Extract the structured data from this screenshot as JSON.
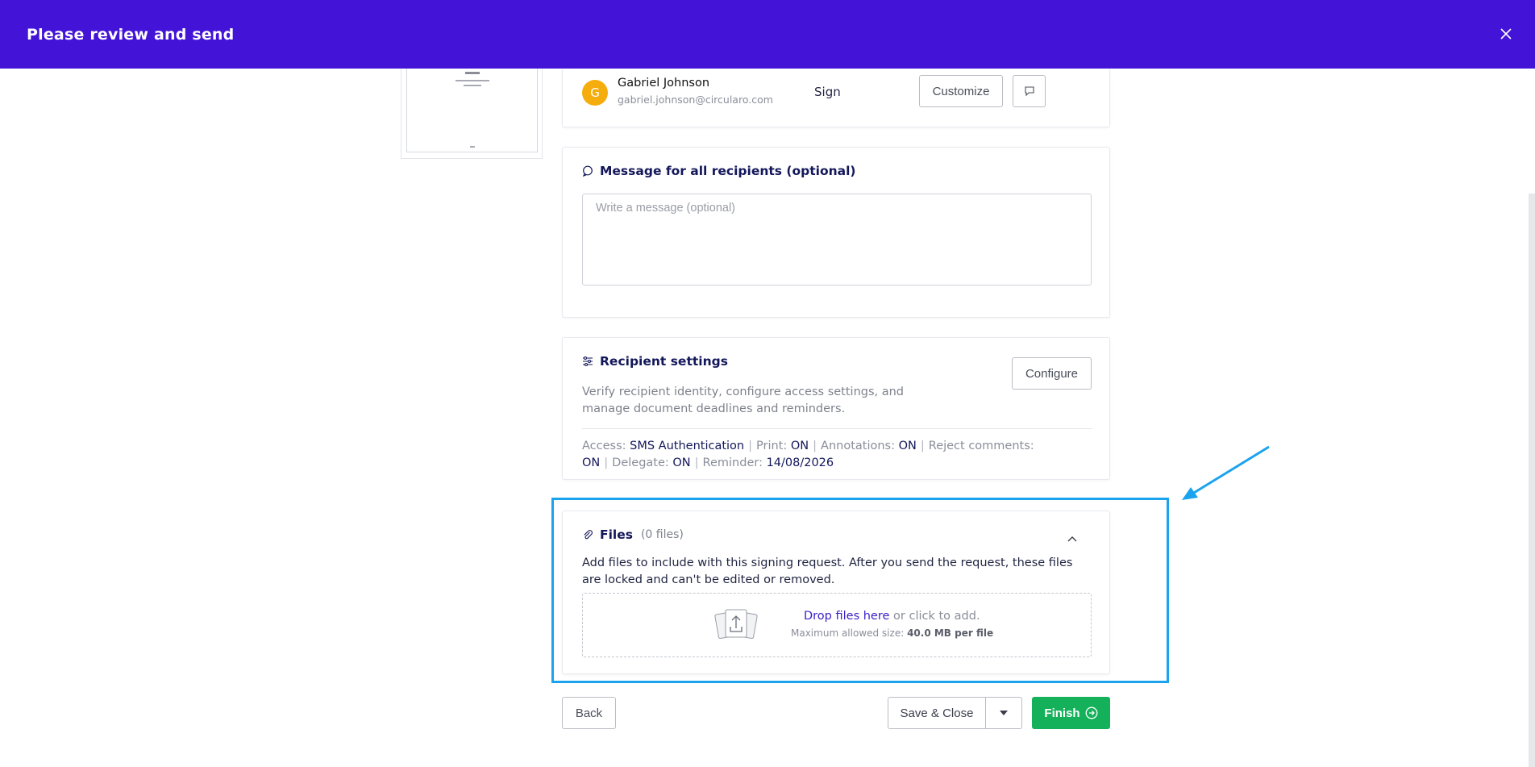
{
  "header": {
    "title": "Please review and send"
  },
  "recipient": {
    "initial": "G",
    "name": "Gabriel Johnson",
    "email": "gabriel.johnson@circularo.com",
    "role": "Sign",
    "customize_label": "Customize"
  },
  "message": {
    "title": "Message for all recipients (optional)",
    "placeholder": "Write a message (optional)"
  },
  "settings": {
    "title": "Recipient settings",
    "description": "Verify recipient identity, configure access settings, and manage document deadlines and reminders.",
    "configure_label": "Configure",
    "access_label": "Access:",
    "access_value": "SMS Authentication",
    "print_label": "Print:",
    "print_value": "ON",
    "annotations_label": "Annotations:",
    "annotations_value": "ON",
    "reject_label": "Reject comments:",
    "reject_value": "ON",
    "delegate_label": "Delegate:",
    "delegate_value": "ON",
    "reminder_label": "Reminder:",
    "reminder_value": "14/08/2026"
  },
  "files": {
    "title": "Files",
    "count": "(0 files)",
    "description": "Add files to include with this signing request. After you send the request, these files are locked and can't be edited or removed.",
    "drop_link": "Drop files here",
    "drop_rest": " or click to add.",
    "max_label": "Maximum allowed size: ",
    "max_value": "40.0 MB per file"
  },
  "footer": {
    "back_label": "Back",
    "save_close_label": "Save & Close",
    "finish_label": "Finish"
  },
  "colors": {
    "header_bg": "#4313d7",
    "finish_bg": "#14b05a",
    "highlight": "#1ba3ee",
    "avatar": "#f5ad0e"
  }
}
